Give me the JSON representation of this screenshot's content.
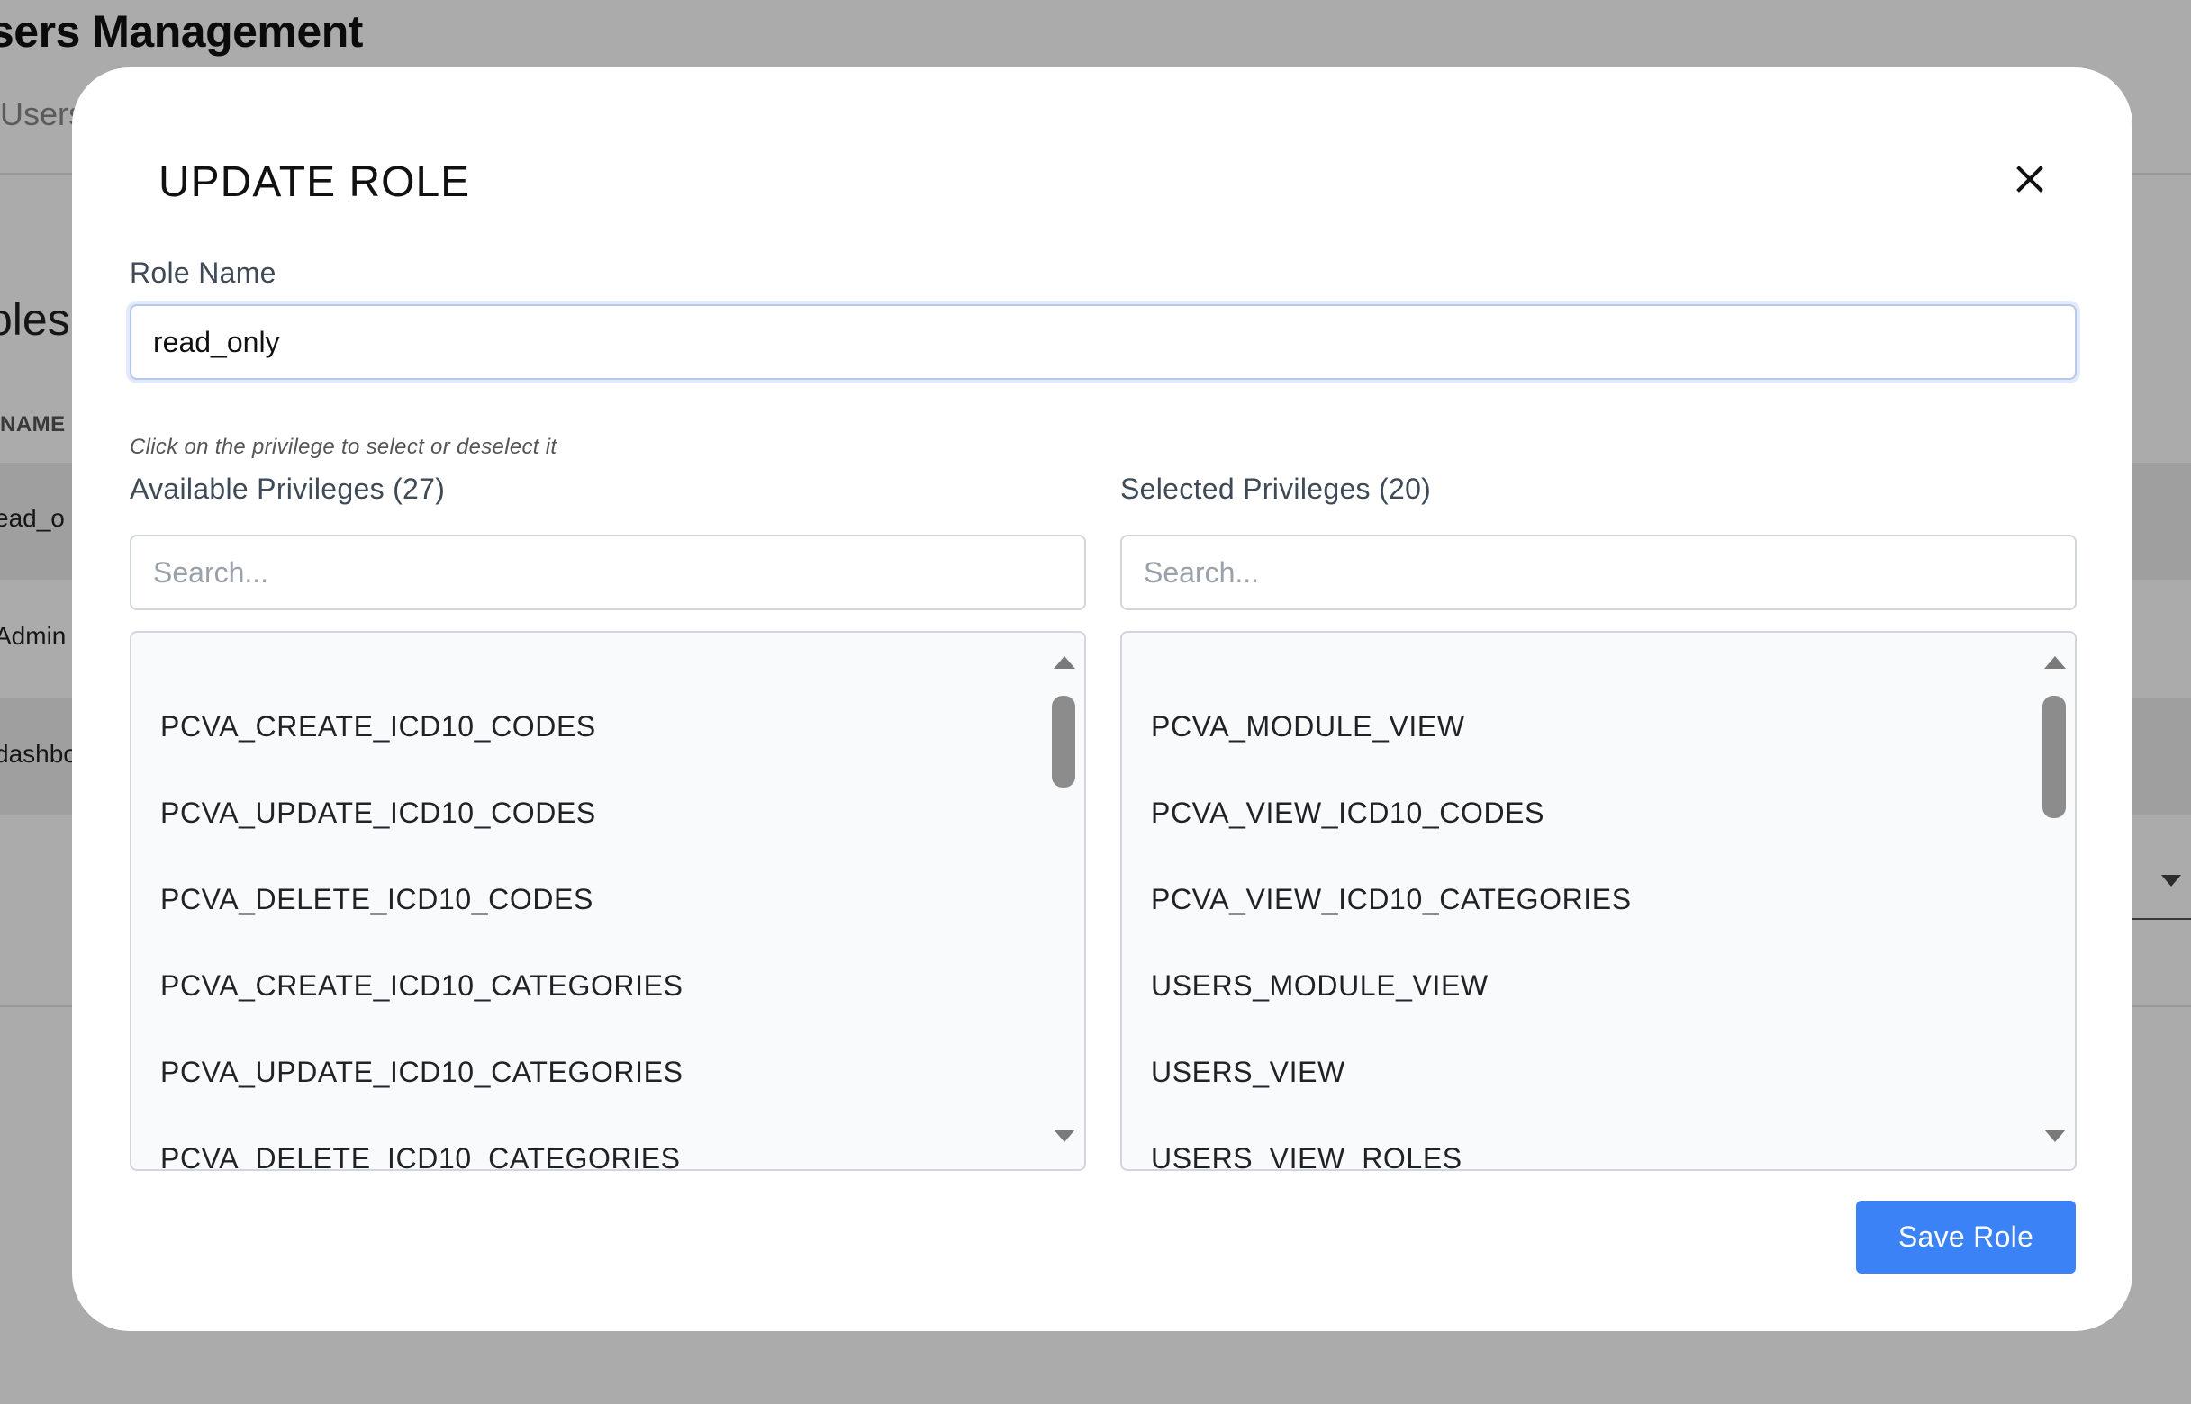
{
  "background": {
    "page_title": "sers Management",
    "tab_label": "Users",
    "section_title": "oles",
    "table_header": "NAME",
    "rows": [
      "ead_o",
      "Admin",
      "dashbo"
    ]
  },
  "modal": {
    "title": "UPDATE ROLE",
    "role_name_label": "Role Name",
    "role_name_value": "read_only",
    "hint": "Click on the privilege to select or deselect it",
    "available": {
      "label": "Available Privileges (27)",
      "search_placeholder": "Search...",
      "items": [
        "PCVA_CREATE_ICD10_CODES",
        "PCVA_UPDATE_ICD10_CODES",
        "PCVA_DELETE_ICD10_CODES",
        "PCVA_CREATE_ICD10_CATEGORIES",
        "PCVA_UPDATE_ICD10_CATEGORIES",
        "PCVA_DELETE_ICD10_CATEGORIES"
      ]
    },
    "selected": {
      "label": "Selected Privileges (20)",
      "search_placeholder": "Search...",
      "items": [
        "PCVA_MODULE_VIEW",
        "PCVA_VIEW_ICD10_CODES",
        "PCVA_VIEW_ICD10_CATEGORIES",
        "USERS_MODULE_VIEW",
        "USERS_VIEW",
        "USERS_VIEW_ROLES"
      ]
    },
    "save_label": "Save Role",
    "close_icon": "close-icon"
  },
  "colors": {
    "primary_button": "#3b82f6",
    "overlay": "rgba(0,0,0,0.33)"
  }
}
